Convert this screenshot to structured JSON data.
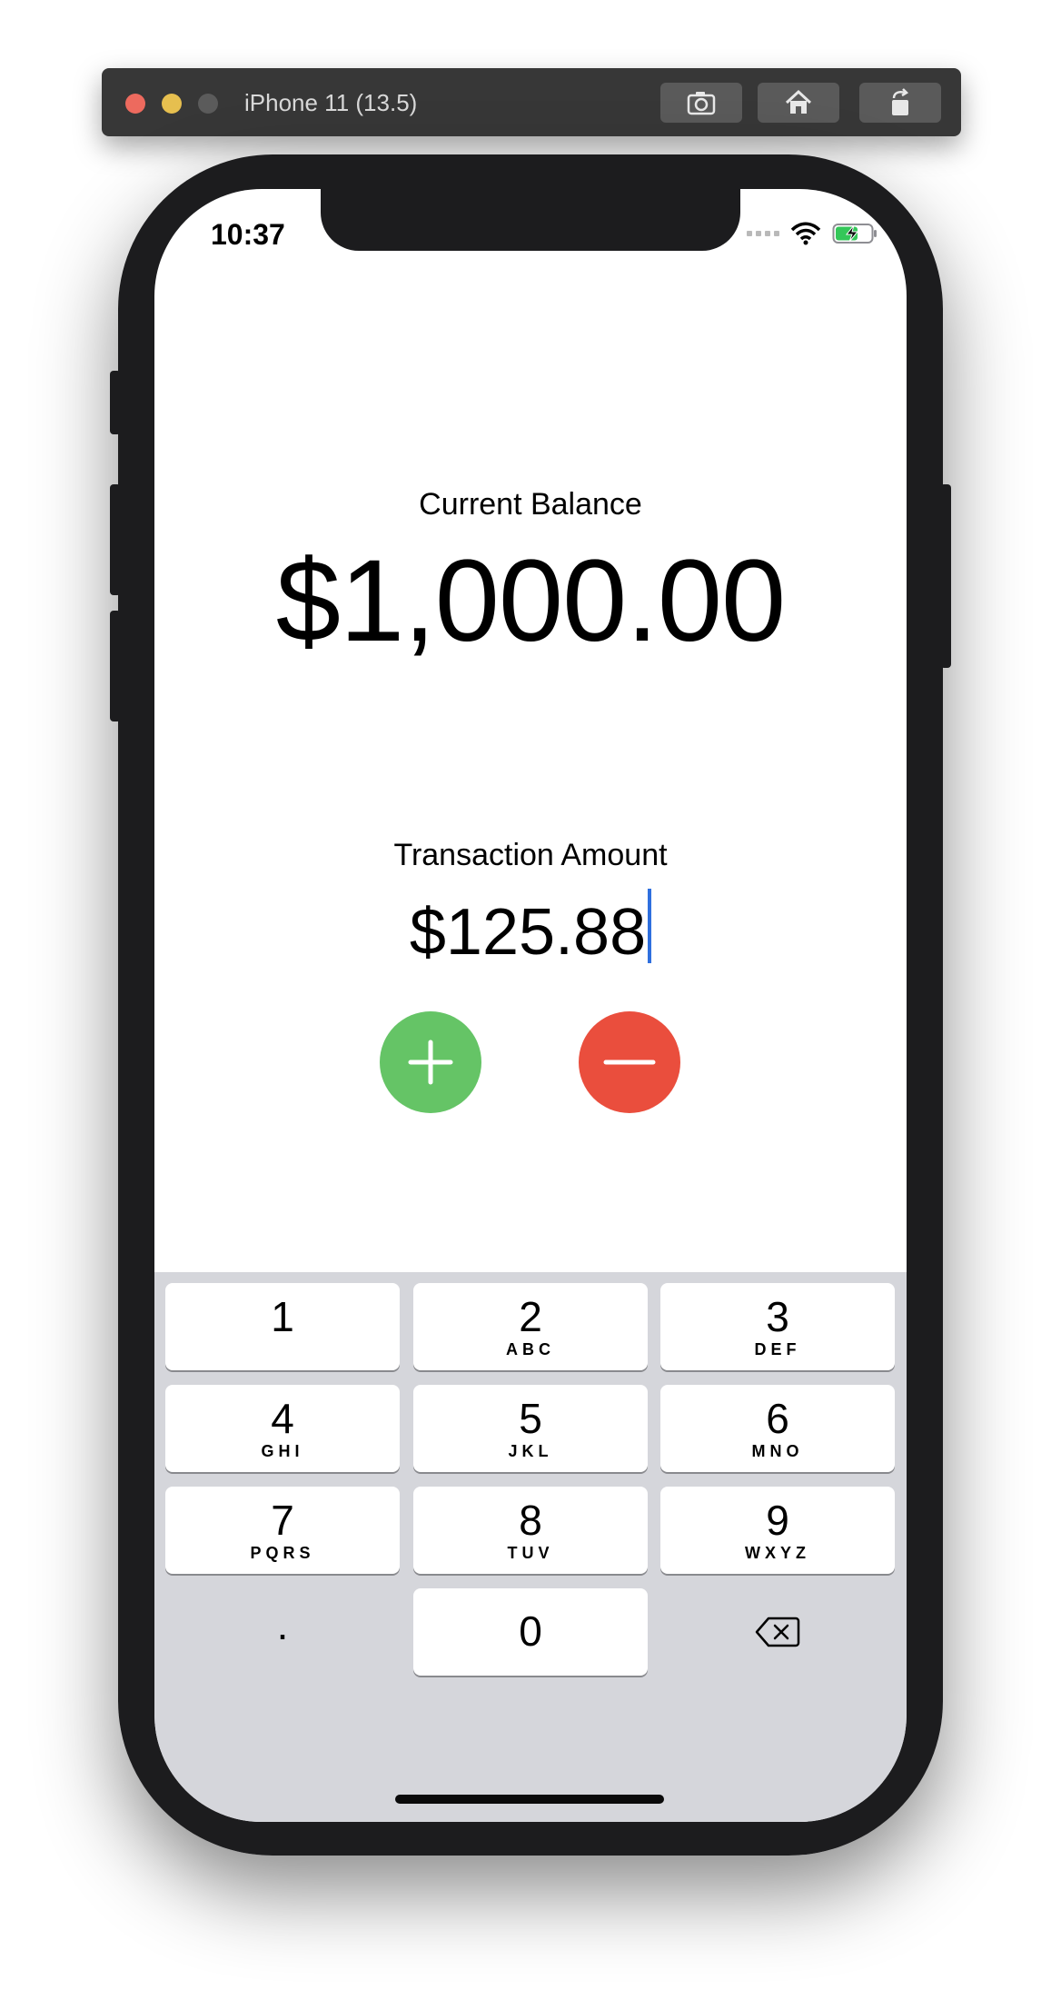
{
  "simulator": {
    "title": "iPhone 11 (13.5)",
    "buttons": [
      "screenshot-icon",
      "home-icon",
      "rotate-icon"
    ]
  },
  "status_bar": {
    "time": "10:37",
    "icons": [
      "cellular-signal-icon",
      "wifi-icon",
      "battery-charging-icon"
    ]
  },
  "balance": {
    "label": "Current Balance",
    "value": "$1,000.00"
  },
  "transaction": {
    "label": "Transaction Amount",
    "value": "$125.88"
  },
  "actions": {
    "add_icon": "plus-icon",
    "subtract_icon": "minus-icon",
    "add_color": "#65c466",
    "subtract_color": "#ea4e3d"
  },
  "keypad": {
    "keys": [
      {
        "digit": "1",
        "letters": ""
      },
      {
        "digit": "2",
        "letters": "ABC"
      },
      {
        "digit": "3",
        "letters": "DEF"
      },
      {
        "digit": "4",
        "letters": "GHI"
      },
      {
        "digit": "5",
        "letters": "JKL"
      },
      {
        "digit": "6",
        "letters": "MNO"
      },
      {
        "digit": "7",
        "letters": "PQRS"
      },
      {
        "digit": "8",
        "letters": "TUV"
      },
      {
        "digit": "9",
        "letters": "WXYZ"
      },
      {
        "digit": "0",
        "letters": ""
      }
    ],
    "decimal": ".",
    "delete_icon": "backspace-icon"
  }
}
